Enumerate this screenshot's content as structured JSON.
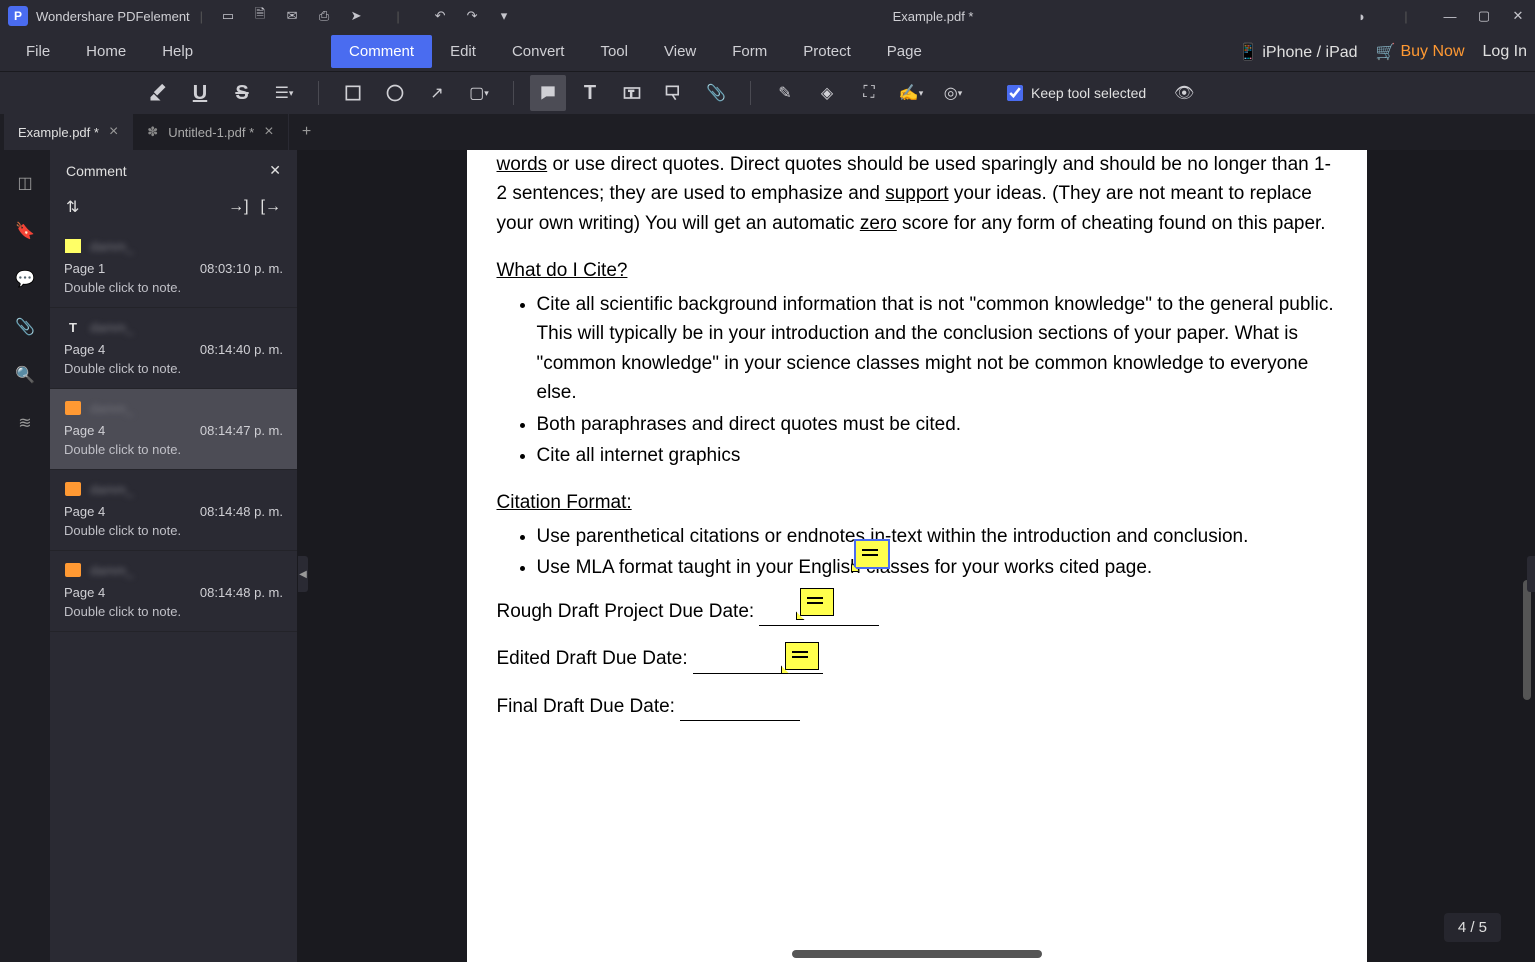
{
  "app": {
    "name": "Wondershare PDFelement",
    "document": "Example.pdf *"
  },
  "qat_icons": [
    "folder",
    "save",
    "mail",
    "print",
    "share",
    "undo",
    "redo",
    "more"
  ],
  "menu": {
    "file": "File",
    "home": "Home",
    "help": "Help",
    "comment": "Comment",
    "edit": "Edit",
    "convert": "Convert",
    "tool": "Tool",
    "view": "View",
    "form": "Form",
    "protect": "Protect",
    "page": "Page"
  },
  "menu_right": {
    "device": "iPhone / iPad",
    "buy": "Buy Now",
    "login": "Log In"
  },
  "toolbar": {
    "keep_label": "Keep tool selected",
    "keep_checked": true
  },
  "tabs": [
    {
      "label": "Example.pdf *",
      "active": true
    },
    {
      "label": "Untitled-1.pdf *",
      "active": false
    }
  ],
  "panel": {
    "title": "Comment",
    "items": [
      {
        "icon": "highlight",
        "author": "damm_",
        "page": "Page 1",
        "time": "08:03:10 p. m.",
        "note": "Double click to note.",
        "selected": false
      },
      {
        "icon": "text",
        "author": "damm_",
        "page": "Page 4",
        "time": "08:14:40 p. m.",
        "note": "Double click to note.",
        "selected": false
      },
      {
        "icon": "note",
        "author": "damm_",
        "page": "Page 4",
        "time": "08:14:47 p. m.",
        "note": "Double click to note.",
        "selected": true
      },
      {
        "icon": "note",
        "author": "damm_",
        "page": "Page 4",
        "time": "08:14:48 p. m.",
        "note": "Double click to note.",
        "selected": false
      },
      {
        "icon": "note",
        "author": "damm_",
        "page": "Page 4",
        "time": "08:14:48 p. m.",
        "note": "Double click to note.",
        "selected": false
      }
    ]
  },
  "doc": {
    "para1a": "words",
    "para1b": " or use direct quotes.   Direct quotes should be used sparingly and should be no longer than 1-2 sentences; they are used to emphasize and ",
    "support": "support",
    "para1c": " your ideas.  (They are not meant to replace your own writing) You will get an automatic ",
    "zero": "zero",
    "para1d": " score for any form of cheating found on this paper.",
    "h1": "What do I Cite?",
    "b1": "Cite all scientific background information that is not \"common knowledge\" to the general public.  This will typically be in your introduction and the conclusion sections of your paper. What is \"common knowledge\" in your science classes might not be common knowledge to everyone else.",
    "b2": "Both paraphrases and direct quotes must be cited.",
    "b3": "Cite all internet graphics",
    "h2": "Citation Format:",
    "c1": "Use parenthetical citations or endnotes in-text within the introduction and conclusion.",
    "c2a": "Use MLA format taught in your En",
    "c2b": "glish",
    "c2c": " classes for your works cited page.",
    "rough": "Rough Draft Project Due Date: ",
    "edited": "Edited Draft Due Date: ",
    "final": "Final Draft Due Date: "
  },
  "page_indicator": "4 / 5"
}
